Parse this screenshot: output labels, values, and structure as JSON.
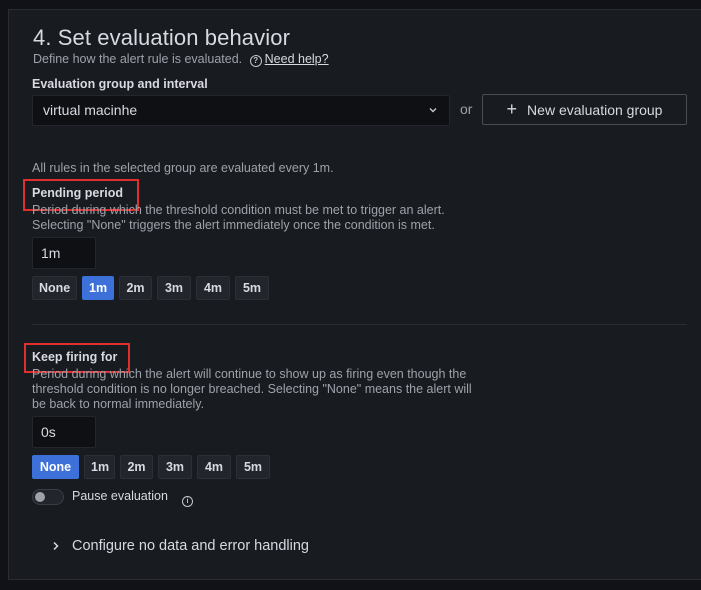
{
  "section": {
    "title": "4. Set evaluation behavior",
    "description": "Define how the alert rule is evaluated.",
    "help_link": "Need help?"
  },
  "evaluation_group": {
    "label": "Evaluation group and interval",
    "selected": "virtual macinhe",
    "or_text": "or",
    "new_button_label": "New evaluation group",
    "info_text": "All rules in the selected group are evaluated every 1m."
  },
  "pending_period": {
    "label": "Pending period",
    "description_line1": "Period during which the threshold condition must be met to trigger an alert.",
    "description_line2": "Selecting \"None\" triggers the alert immediately once the condition is met.",
    "value": "1m",
    "options": [
      "None",
      "1m",
      "2m",
      "3m",
      "4m",
      "5m"
    ],
    "selected": "1m"
  },
  "keep_firing": {
    "label": "Keep firing for",
    "description_line1": "Period during which the alert will continue to show up as firing even though the",
    "description_line2": "threshold condition is no longer breached. Selecting \"None\" means the alert will",
    "description_line3": "be back to normal immediately.",
    "value": "0s",
    "options": [
      "None",
      "1m",
      "2m",
      "3m",
      "4m",
      "5m"
    ],
    "selected": "None"
  },
  "pause": {
    "label": "Pause evaluation",
    "enabled": false
  },
  "no_data": {
    "label": "Configure no data and error handling"
  },
  "colors": {
    "background": "#111217",
    "panel": "#181b1f",
    "accent": "#3d71d9",
    "highlight_box": "#e02f2f"
  }
}
